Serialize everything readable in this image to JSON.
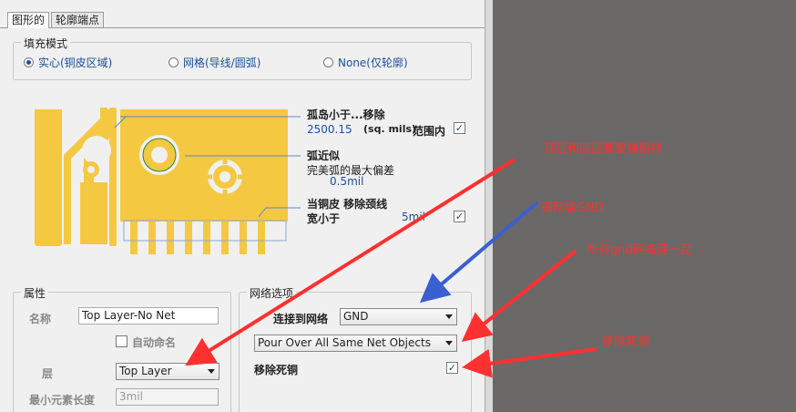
{
  "tabs": [
    {
      "label": "图形的"
    },
    {
      "label": "轮廓端点"
    }
  ],
  "fill_mode": {
    "title": "填充模式",
    "options": [
      {
        "label": "实心(铜皮区域)",
        "selected": true
      },
      {
        "label": "网格(导线/圆弧)",
        "selected": false
      },
      {
        "label": "None(仅轮廓)",
        "selected": false
      }
    ]
  },
  "island": {
    "title": "孤岛小于...移除",
    "value": "2500.15",
    "unit": "(sq. mils)",
    "range": "范围内",
    "checked": true
  },
  "arc": {
    "title": "弧近似",
    "desc": "完美弧的最大偏差",
    "value": "0.5mil"
  },
  "neck": {
    "title": "当铜皮  移除颈线",
    "subtitle": "宽小于",
    "value": "5mil",
    "checked": true
  },
  "properties": {
    "title": "属性",
    "name_label": "名称",
    "name_value": "Top Layer-No Net",
    "auto_name": "自动命名",
    "auto_checked": false,
    "layer_label": "层",
    "layer_value": "Top Layer",
    "min_label": "最小元素长度",
    "min_value": "3mil"
  },
  "net": {
    "title": "网络选项",
    "connect_label": "连接到网络",
    "connect_value": "GND",
    "pour_value": "Pour Over All Same Net Objects",
    "dead_label": "移除死铜",
    "dead_checked": true
  },
  "annotations": {
    "a1": "顶层和底层都要铺铜线",
    "a2": "铺网络GND",
    "a3": "所有gnd网络连一起",
    "a4": "移除死铜"
  },
  "colors": {
    "copper": "#f5c842",
    "annotation": "#ff3030",
    "blue_arrow": "#3a5fd0"
  },
  "check_glyph": "✓"
}
